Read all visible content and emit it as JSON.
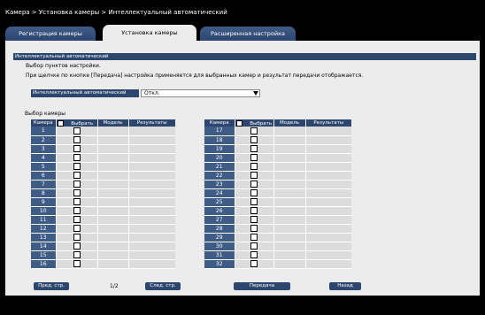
{
  "breadcrumb": "Камера > Установка камеры > Интеллектуальный автоматический",
  "tabs": [
    {
      "label": "Регистрация камеры"
    },
    {
      "label": "Установка камеры"
    },
    {
      "label": "Расширенная настройка"
    }
  ],
  "section_title": "Интеллектуальный автоматический",
  "instruction1": "Выбор пунктов настройки.",
  "instruction2": "При щелчке по кнопке [Передача] настройка применяется для выбранных камер и результат передачи отображается.",
  "setting": {
    "label": "Интеллектуальный автоматический",
    "value": "Откл."
  },
  "camera_select_title": "Выбор камеры",
  "table_headers": {
    "camera": "Камера",
    "select": "Выбрать",
    "model": "Модель",
    "results": "Результаты"
  },
  "cameras_left": [
    "1",
    "2",
    "3",
    "4",
    "5",
    "6",
    "7",
    "8",
    "9",
    "10",
    "11",
    "12",
    "13",
    "14",
    "15",
    "16"
  ],
  "cameras_right": [
    "17",
    "18",
    "19",
    "20",
    "21",
    "22",
    "23",
    "24",
    "25",
    "26",
    "27",
    "28",
    "29",
    "30",
    "31",
    "32"
  ],
  "buttons": {
    "prev_page": "Пред. стр.",
    "next_page": "След. стр.",
    "transfer": "Передача",
    "back": "Назад"
  },
  "page_indicator": "1/2"
}
